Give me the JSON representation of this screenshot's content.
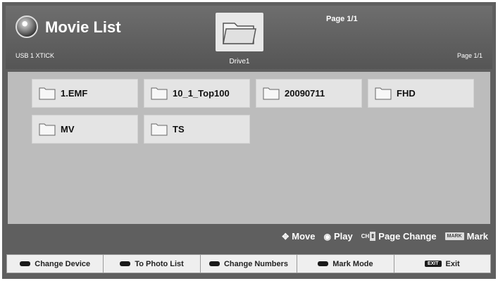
{
  "header": {
    "title": "Movie List",
    "device": "USB 1 XTICK",
    "drive_label": "Drive1",
    "page_top": "Page 1/1",
    "page_right": "Page 1/1"
  },
  "folders": [
    {
      "name": "1.EMF"
    },
    {
      "name": "10_1_Top100"
    },
    {
      "name": "20090711"
    },
    {
      "name": "FHD"
    },
    {
      "name": "MV"
    },
    {
      "name": "TS"
    }
  ],
  "hints": {
    "move": "Move",
    "play": "Play",
    "ch_label": "CH",
    "page_change": "Page Change",
    "mark_key": "MARK",
    "mark": "Mark"
  },
  "bottom_buttons": {
    "change_device": "Change Device",
    "to_photo_list": "To Photo List",
    "change_numbers": "Change Numbers",
    "mark_mode": "Mark Mode",
    "exit_key": "EXIT",
    "exit": "Exit"
  },
  "colors": {
    "background": "#5f5f5f",
    "content_panel": "#bcbcbc",
    "folder_tile": "#e4e4e4"
  },
  "icons": [
    "disc-icon",
    "folder-icon",
    "move-arrows-icon",
    "play-dot-icon"
  ]
}
